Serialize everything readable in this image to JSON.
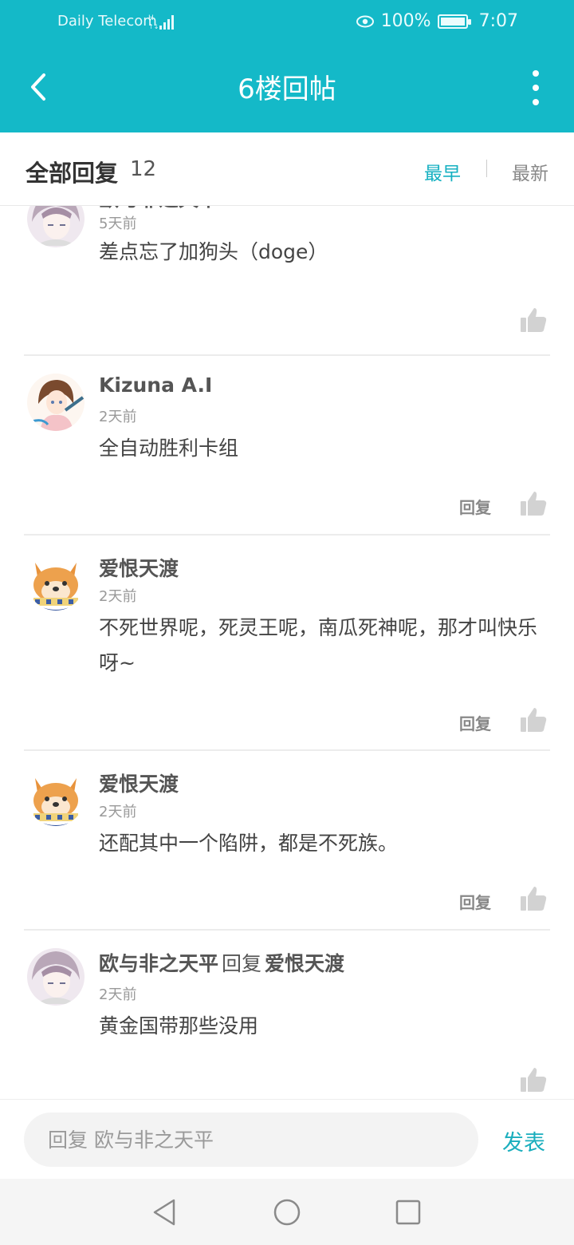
{
  "status_bar": {
    "carrier": "Daily Telecom",
    "battery": "100%",
    "time": "7:07"
  },
  "nav": {
    "title": "6楼回帖"
  },
  "header": {
    "all_label": "全部回复",
    "count": "12",
    "sort_earliest": "最早",
    "sort_latest": "最新"
  },
  "replies": [
    {
      "author": "欧与非之天平",
      "time": "5天前",
      "content": "差点忘了加狗头（doge）",
      "reply_label": ""
    },
    {
      "author": "Kizuna A.I",
      "time": "2天前",
      "content": "全自动胜利卡组",
      "reply_label": "回复"
    },
    {
      "author": "爱恨天渡",
      "time": "2天前",
      "content": "不死世界呢，死灵王呢，南瓜死神呢，那才叫快乐呀~",
      "reply_label": "回复"
    },
    {
      "author": "爱恨天渡",
      "time": "2天前",
      "content": "还配其中一个陷阱，都是不死族。",
      "reply_label": "回复"
    },
    {
      "author": "欧与非之天平",
      "reply_word": "回复",
      "reply_to": "爱恨天渡",
      "time": "2天前",
      "content": "黄金国带那些没用",
      "reply_label": ""
    }
  ],
  "bottom": {
    "input_placeholder": "回复 欧与非之天平",
    "send_label": "发表"
  },
  "colors": {
    "primary": "#14b9c8",
    "accent_text": "#14b0c1"
  },
  "icons": [
    "back-icon",
    "more-icon",
    "eye-icon",
    "battery-icon",
    "signal-icon",
    "thumb-up-icon",
    "nav-back-icon",
    "nav-home-icon",
    "nav-recents-icon"
  ]
}
